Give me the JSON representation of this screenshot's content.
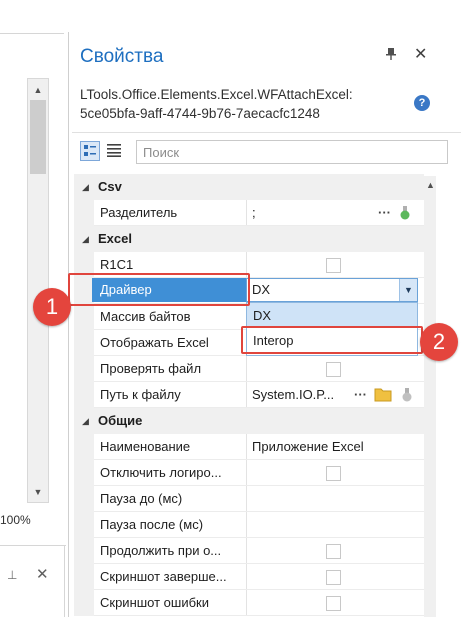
{
  "left_panel": {
    "zoom": "100%",
    "pin_icon": "pin-icon",
    "close_icon": "close-icon"
  },
  "properties": {
    "title": "Свойства",
    "object_type_line1": "LTools.Office.Elements.Excel.WFAttachExcel:",
    "object_type_line2": "5ce05bfa-9aff-4744-9b76-7aecacfc1248",
    "search_placeholder": "Поиск"
  },
  "categories": [
    {
      "name": "Csv",
      "rows": [
        {
          "name": "Разделитель",
          "value": ";",
          "editor": "ellipsis-flask"
        }
      ]
    },
    {
      "name": "Excel",
      "rows": [
        {
          "name": "R1C1",
          "value": "",
          "editor": "checkbox"
        },
        {
          "name": "Драйвер",
          "value": "DX",
          "editor": "dropdown",
          "selected": true
        },
        {
          "name": "Массив байтов",
          "value": "",
          "editor": "none"
        },
        {
          "name": "Отображать Excel",
          "value": "",
          "editor": "none"
        },
        {
          "name": "Проверять файл",
          "value": "",
          "editor": "checkbox"
        },
        {
          "name": "Путь к файлу",
          "value": "System.IO.P...",
          "editor": "ellipsis-folder-flask"
        }
      ]
    },
    {
      "name": "Общие",
      "rows": [
        {
          "name": "Наименование",
          "value": "Приложение Excel",
          "editor": "none"
        },
        {
          "name": "Отключить логиро...",
          "value": "",
          "editor": "checkbox"
        },
        {
          "name": "Пауза до (мс)",
          "value": "",
          "editor": "none"
        },
        {
          "name": "Пауза после (мс)",
          "value": "",
          "editor": "none"
        },
        {
          "name": "Продолжить при о...",
          "value": "",
          "editor": "checkbox"
        },
        {
          "name": "Скриншот заверше...",
          "value": "",
          "editor": "checkbox"
        },
        {
          "name": "Скриншот ошибки",
          "value": "",
          "editor": "checkbox"
        }
      ]
    }
  ],
  "dropdown_options": [
    "DX",
    "Interop"
  ],
  "annotations": {
    "badge1": "1",
    "badge2": "2"
  },
  "colors": {
    "accent": "#1e6fc0",
    "selection": "#3f8fd6",
    "annotation_red": "#e4453d"
  }
}
